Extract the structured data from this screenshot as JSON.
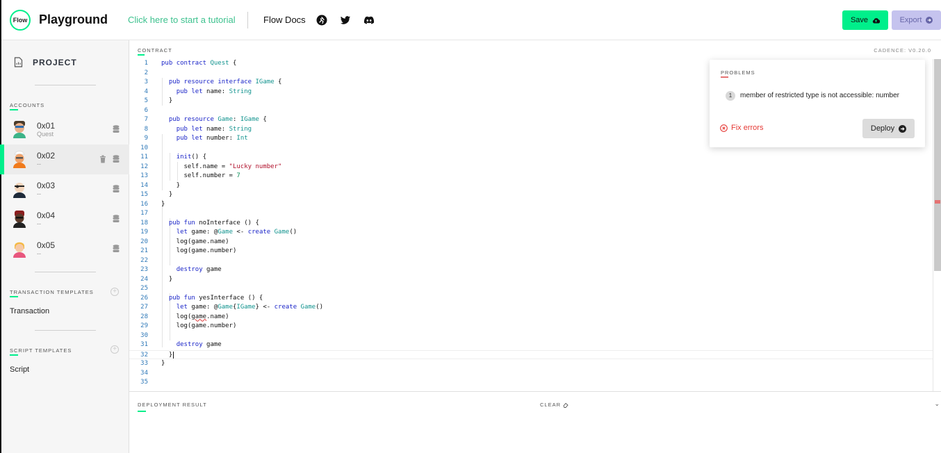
{
  "header": {
    "logo_text": "Flow",
    "title": "Playground",
    "tutorial_link": "Click here to start a tutorial",
    "docs_link": "Flow Docs",
    "social_icons": [
      "runner-icon",
      "twitter-icon",
      "discord-icon"
    ],
    "save_label": "Save",
    "export_label": "Export"
  },
  "sidebar": {
    "project_label": "PROJECT",
    "accounts_label": "ACCOUNTS",
    "accounts": [
      {
        "address": "0x01",
        "contract": "Quest"
      },
      {
        "address": "0x02",
        "contract": "--"
      },
      {
        "address": "0x03",
        "contract": "--"
      },
      {
        "address": "0x04",
        "contract": "--"
      },
      {
        "address": "0x05",
        "contract": "--"
      }
    ],
    "transaction_templates_label": "TRANSACTION TEMPLATES",
    "transaction_item": "Transaction",
    "script_templates_label": "SCRIPT TEMPLATES",
    "script_item": "Script"
  },
  "editor": {
    "label": "CONTRACT",
    "version": "CADENCE: V0.20.0",
    "lines": [
      "pub contract Quest {",
      "",
      "  pub resource interface IGame {",
      "    pub let name: String",
      "  }",
      "",
      "  pub resource Game: IGame {",
      "    pub let name: String",
      "    pub let number: Int",
      "",
      "    init() {",
      "      self.name = \"Lucky number\"",
      "      self.number = 7",
      "    }",
      "  }",
      "}",
      "",
      "  pub fun noInterface () {",
      "    let game: @Game <- create Game()",
      "    log(game.name)",
      "    log(game.number)",
      "",
      "    destroy game",
      "  }",
      "",
      "  pub fun yesInterface () {",
      "    let game: @Game{IGame} <- create Game()",
      "    log(game.name)",
      "    log(game.number)",
      "",
      "    destroy game",
      "  }",
      "}",
      "",
      ""
    ]
  },
  "problems": {
    "title": "PROBLEMS",
    "count": "1",
    "message": "member of restricted type is not accessible: number",
    "fix_label": "Fix errors",
    "deploy_label": "Deploy"
  },
  "results": {
    "label": "DEPLOYMENT RESULT",
    "clear_label": "CLEAR"
  },
  "colors": {
    "accent": "#00ef8b",
    "export_bg": "#c5c3ee",
    "error": "#e53935"
  }
}
